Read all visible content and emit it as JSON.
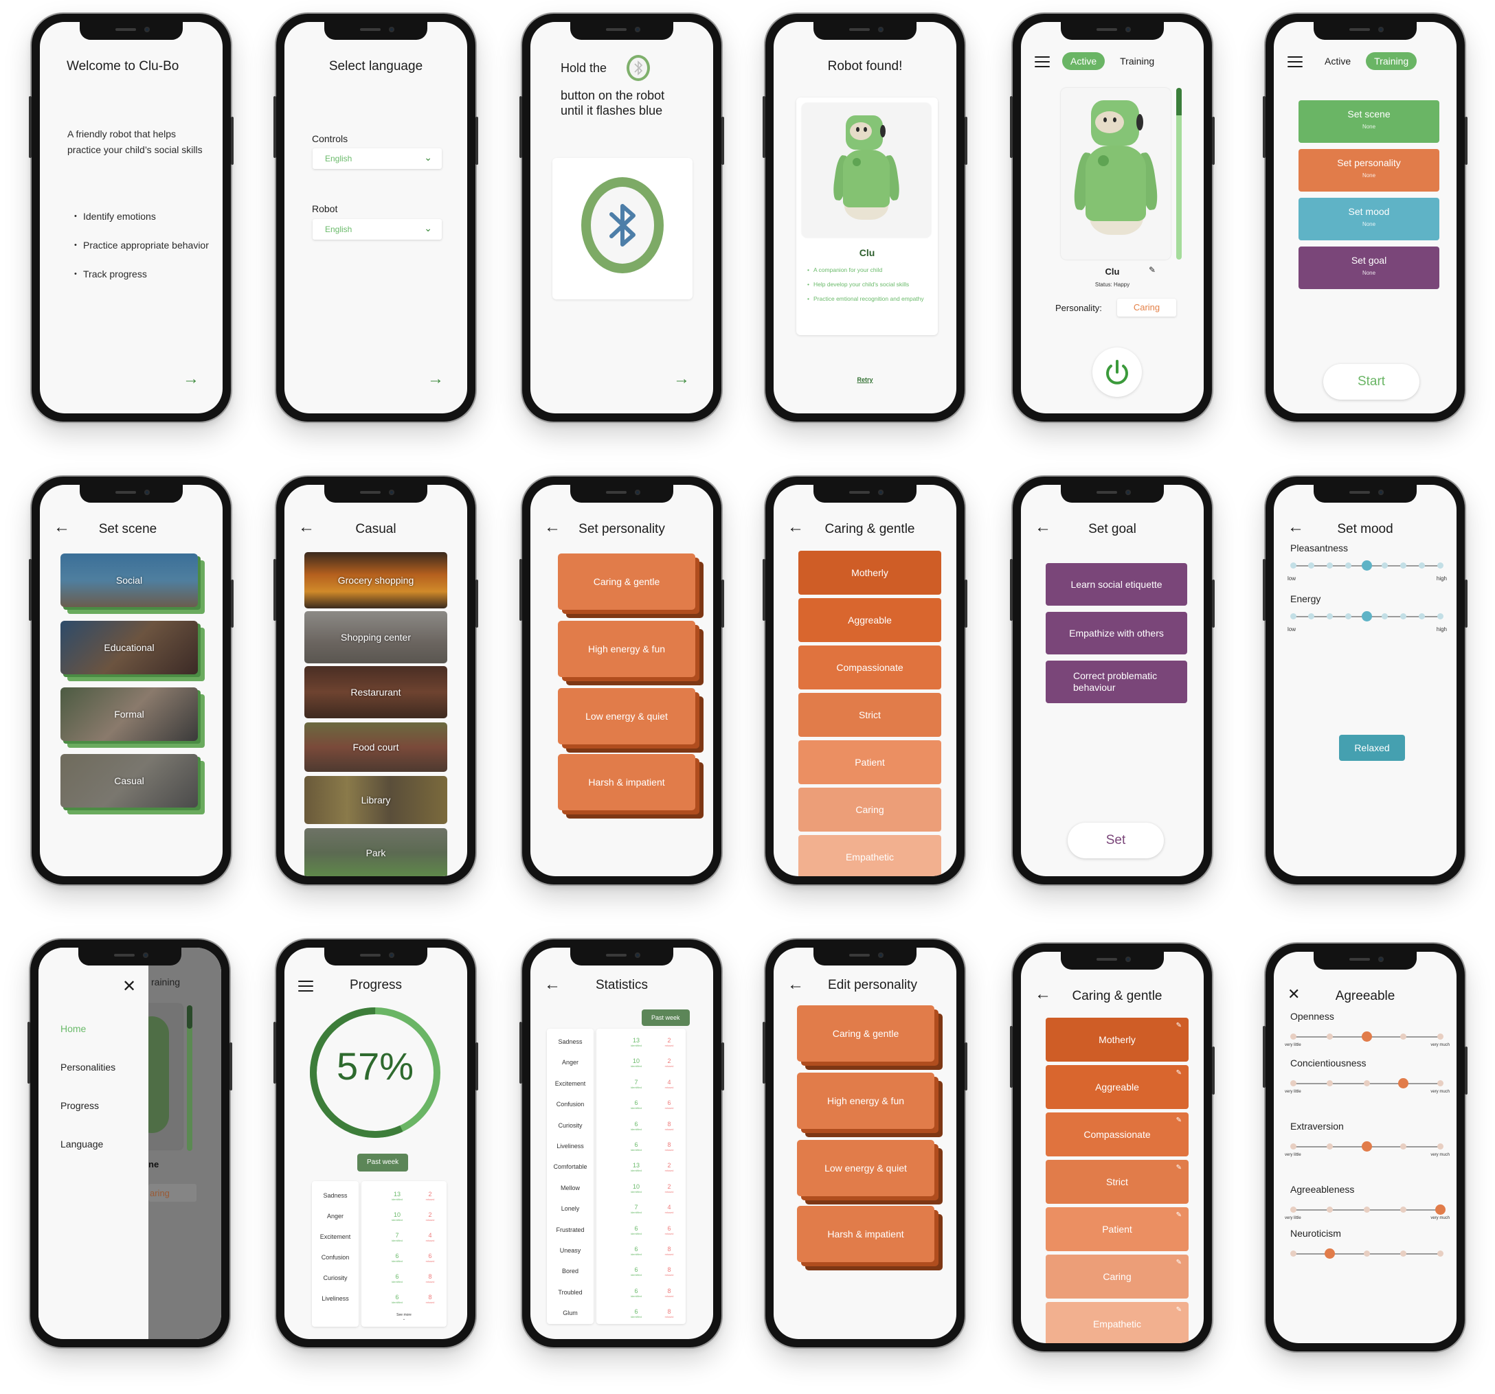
{
  "colors": {
    "green": "#6ab565",
    "dark_green": "#2e6a2e",
    "orange": "#e17c4a",
    "blue": "#5fb3c6",
    "purple": "#7a4679",
    "teal": "#45a0b0",
    "missed_red": "#ef7b7b"
  },
  "welcome": {
    "title": "Welcome to Clu-Bo",
    "intro": "A friendly robot that helps practice your child’s social skills",
    "bullets": [
      "Identify emotions",
      "Practice appropriate behavior",
      "Track progress"
    ],
    "next_icon": "→"
  },
  "language": {
    "title": "Select language",
    "controls_label": "Controls",
    "controls_value": "English",
    "robot_label": "Robot",
    "robot_value": "English",
    "next_icon": "→"
  },
  "pairing": {
    "line1": "Hold the",
    "line2": "button on the robot",
    "line3": "until it flashes blue",
    "next_icon": "→"
  },
  "found": {
    "title": "Robot found!",
    "robot_name": "Clu",
    "bullets": [
      "A companion for your child",
      "Help develop your child's social skills",
      "Practice emtional recognition and empathy"
    ],
    "retry": "Retry"
  },
  "home_active": {
    "tabs": [
      "Active",
      "Training"
    ],
    "active_tab": "Active",
    "robot_name": "Clu",
    "status": "Status: Happy",
    "personality_label": "Personality:",
    "personality_value": "Caring",
    "battery_level_pct": 84
  },
  "home_training": {
    "tabs": [
      "Active",
      "Training"
    ],
    "active_tab": "Training",
    "cards": [
      {
        "label": "Set scene",
        "value": "None",
        "color": "#6ab565"
      },
      {
        "label": "Set personality",
        "value": "None",
        "color": "#e17c4a"
      },
      {
        "label": "Set mood",
        "value": "None",
        "color": "#5fb3c6"
      },
      {
        "label": "Set goal",
        "value": "None",
        "color": "#7a4679"
      }
    ],
    "start": "Start"
  },
  "set_scene": {
    "title": "Set scene",
    "scenes": [
      "Social",
      "Educational",
      "Formal",
      "Casual"
    ]
  },
  "casual": {
    "title": "Casual",
    "places": [
      "Grocery shopping",
      "Shopping center",
      "Restarurant",
      "Food court",
      "Library",
      "Park"
    ]
  },
  "set_personality": {
    "title": "Set personality",
    "options": [
      "Caring & gentle",
      "High energy & fun",
      "Low energy & quiet",
      "Harsh & impatient"
    ]
  },
  "caring_gentle": {
    "title": "Caring & gentle",
    "traits": [
      {
        "label": "Motherly",
        "color": "#cf5d26"
      },
      {
        "label": "Aggreable",
        "color": "#d9662e"
      },
      {
        "label": "Compassionate",
        "color": "#e0733e"
      },
      {
        "label": "Strict",
        "color": "#e17c4a"
      },
      {
        "label": "Patient",
        "color": "#eb8f62"
      },
      {
        "label": "Caring",
        "color": "#ec9e78"
      },
      {
        "label": "Empathetic",
        "color": "#f2b08f"
      }
    ]
  },
  "set_goal": {
    "title": "Set goal",
    "goals": [
      "Learn social etiquette",
      "Empathize with others",
      "Correct problematic behaviour"
    ],
    "set": "Set"
  },
  "set_mood": {
    "title": "Set mood",
    "sliders": [
      {
        "label": "Pleasantness",
        "steps": 9,
        "selected": 5,
        "low": "low",
        "high": "high"
      },
      {
        "label": "Energy",
        "steps": 9,
        "selected": 5,
        "low": "low",
        "high": "high"
      }
    ],
    "result": "Relaxed"
  },
  "drawer": {
    "items": [
      "Home",
      "Personalities",
      "Progress",
      "Language"
    ],
    "active": "Home",
    "bg_tab": "raining",
    "bg_name": "ne",
    "bg_personality": "aring"
  },
  "progress": {
    "title": "Progress",
    "percent": 57,
    "percent_label": "57%",
    "range": "Past week",
    "identified_label": "identified",
    "missed_label": "missed",
    "see_more": "See more",
    "rows": [
      {
        "emotion": "Sadness",
        "identified": 13,
        "missed": 2
      },
      {
        "emotion": "Anger",
        "identified": 10,
        "missed": 2
      },
      {
        "emotion": "Excitement",
        "identified": 7,
        "missed": 4
      },
      {
        "emotion": "Confusion",
        "identified": 6,
        "missed": 6
      },
      {
        "emotion": "Curiosity",
        "identified": 6,
        "missed": 8
      },
      {
        "emotion": "Liveliness",
        "identified": 6,
        "missed": 8
      }
    ]
  },
  "statistics": {
    "title": "Statistics",
    "range": "Past week",
    "identified_label": "identified",
    "missed_label": "missed",
    "rows": [
      {
        "emotion": "Sadness",
        "identified": 13,
        "missed": 2
      },
      {
        "emotion": "Anger",
        "identified": 10,
        "missed": 2
      },
      {
        "emotion": "Excitement",
        "identified": 7,
        "missed": 4
      },
      {
        "emotion": "Confusion",
        "identified": 6,
        "missed": 6
      },
      {
        "emotion": "Curiosity",
        "identified": 6,
        "missed": 8
      },
      {
        "emotion": "Liveliness",
        "identified": 6,
        "missed": 8
      },
      {
        "emotion": "Comfortable",
        "identified": 13,
        "missed": 2
      },
      {
        "emotion": "Mellow",
        "identified": 10,
        "missed": 2
      },
      {
        "emotion": "Lonely",
        "identified": 7,
        "missed": 4
      },
      {
        "emotion": "Frustrated",
        "identified": 6,
        "missed": 6
      },
      {
        "emotion": "Uneasy",
        "identified": 6,
        "missed": 8
      },
      {
        "emotion": "Bored",
        "identified": 6,
        "missed": 8
      },
      {
        "emotion": "Troubled",
        "identified": 6,
        "missed": 8
      },
      {
        "emotion": "Glum",
        "identified": 6,
        "missed": 8
      }
    ]
  },
  "edit_personality": {
    "title": "Edit personality",
    "options": [
      "Caring & gentle",
      "High energy & fun",
      "Low energy & quiet",
      "Harsh & impatient"
    ]
  },
  "caring_gentle_edit": {
    "title": "Caring & gentle",
    "traits": [
      {
        "label": "Motherly",
        "color": "#cf5d26"
      },
      {
        "label": "Aggreable",
        "color": "#d9662e"
      },
      {
        "label": "Compassionate",
        "color": "#e0733e"
      },
      {
        "label": "Strict",
        "color": "#e17c4a"
      },
      {
        "label": "Patient",
        "color": "#eb8f62"
      },
      {
        "label": "Caring",
        "color": "#ec9e78"
      },
      {
        "label": "Empathetic",
        "color": "#f2b08f"
      }
    ]
  },
  "agreeable": {
    "title": "Agreeable",
    "low": "very little",
    "high": "very much",
    "sliders": [
      {
        "label": "Openness",
        "steps": 5,
        "selected": 3
      },
      {
        "label": "Concientiousness",
        "steps": 5,
        "selected": 4
      },
      {
        "label": "Extraversion",
        "steps": 5,
        "selected": 3
      },
      {
        "label": "Agreeableness",
        "steps": 5,
        "selected": 5
      },
      {
        "label": "Neuroticism",
        "steps": 5,
        "selected": 2
      }
    ]
  }
}
